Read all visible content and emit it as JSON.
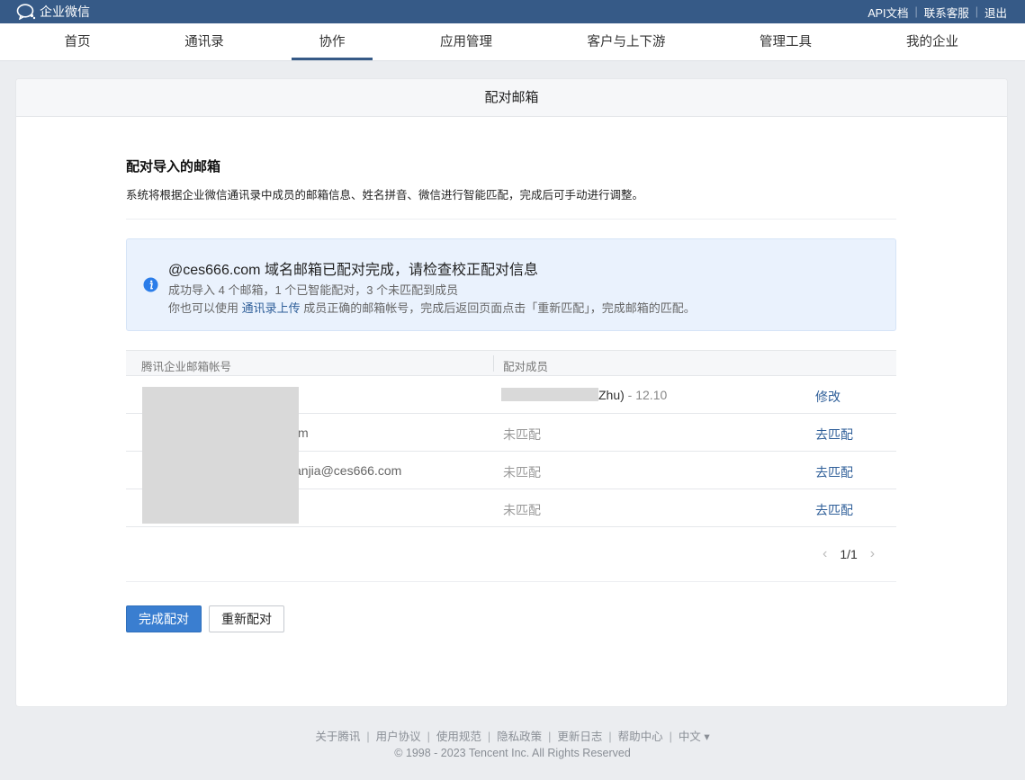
{
  "topbar": {
    "app_name": "企业微信",
    "links": [
      "API文档",
      "联系客服",
      "退出"
    ]
  },
  "nav": {
    "tabs": [
      "首页",
      "通讯录",
      "协作",
      "应用管理",
      "客户与上下游",
      "管理工具",
      "我的企业"
    ],
    "active_index": 2
  },
  "card": {
    "title": "配对邮箱",
    "section_title": "配对导入的邮箱",
    "section_desc": "系统将根据企业微信通讯录中成员的邮箱信息、姓名拼音、微信进行智能匹配，完成后可手动进行调整。"
  },
  "notice": {
    "title": "@ces666.com 域名邮箱已配对完成，请检查校正配对信息",
    "line1": "成功导入 4 个邮箱，1 个已智能配对，3 个未匹配到成员",
    "line2_prefix": "你也可以使用 ",
    "line2_link": "通讯录上传",
    "line2_suffix": " 成员正确的邮箱帐号，完成后返回页面点击「重新匹配」，完成邮箱的匹配。"
  },
  "table": {
    "headers": [
      "腾讯企业邮箱帐号",
      "配对成员"
    ],
    "rows": [
      {
        "email": "",
        "member": "Zhu)",
        "member_dept": " - 12.10",
        "matched": true,
        "action": "修改"
      },
      {
        "email": "m",
        "member": "未匹配",
        "member_dept": "",
        "matched": false,
        "action": "去匹配"
      },
      {
        "email": "anjia@ces666.com",
        "member": "未匹配",
        "member_dept": "",
        "matched": false,
        "action": "去匹配"
      },
      {
        "email": "",
        "member": "未匹配",
        "member_dept": "",
        "matched": false,
        "action": "去匹配"
      }
    ]
  },
  "pager": {
    "text": "1/1",
    "prev_icon": "chevron-left-icon",
    "next_icon": "chevron-right-icon"
  },
  "buttons": {
    "finish": "完成配对",
    "rematch": "重新配对"
  },
  "footer": {
    "links": [
      "关于腾讯",
      "用户协议",
      "使用规范",
      "隐私政策",
      "更新日志",
      "帮助中心",
      "中文 ▾"
    ],
    "copyright": "© 1998 - 2023 Tencent Inc. All Rights Reserved"
  },
  "colors": {
    "brand": "#365a87",
    "primary_button": "#3a7ed0",
    "link": "#2f5f99",
    "notice_bg": "#eaf2fd"
  }
}
